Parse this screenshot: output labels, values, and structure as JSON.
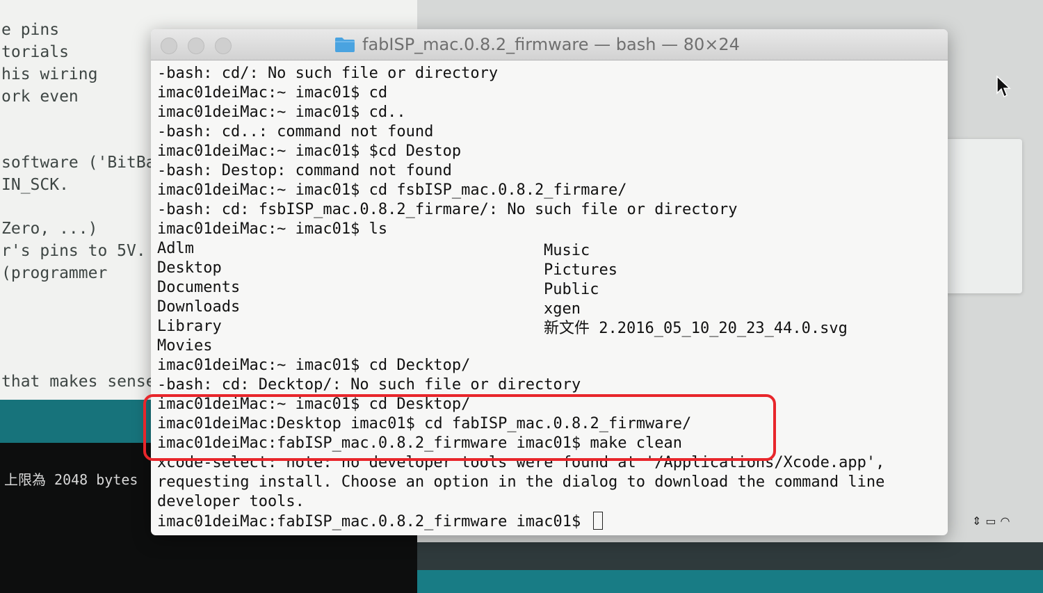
{
  "background": {
    "left_doc_lines": [
      "e pins",
      "torials",
      "his wiring",
      "ork even",
      "software ('BitBa",
      "IN_SCK.",
      "Zero, ...)",
      "r's pins to 5V.",
      "(programmer",
      "that makes sense"
    ],
    "console_line": "上限為 2048 bytes"
  },
  "terminal": {
    "title": "fabISP_mac.0.8.2_firmware — bash — 80×24",
    "lines": [
      "-bash: cd/: No such file or directory",
      "imac01deiMac:~ imac01$ cd",
      "imac01deiMac:~ imac01$ cd..",
      "-bash: cd..: command not found",
      "imac01deiMac:~ imac01$ $cd Destop",
      "-bash: Destop: command not found",
      "imac01deiMac:~ imac01$ cd fsbISP_mac.0.8.2_firmare/",
      "-bash: cd: fsbISP_mac.0.8.2_firmare/: No such file or directory",
      "imac01deiMac:~ imac01$ ls"
    ],
    "ls_left": [
      "Adlm",
      "Desktop",
      "Documents",
      "Downloads",
      "Library",
      "Movies"
    ],
    "ls_right": [
      "Music",
      "Pictures",
      "Public",
      "xgen",
      "新文件 2.2016_05_10_20_23_44.0.svg"
    ],
    "after_ls": [
      "imac01deiMac:~ imac01$ cd Decktop/",
      "-bash: cd: Decktop/: No such file or directory"
    ],
    "highlighted": [
      "imac01deiMac:~ imac01$ cd Desktop/",
      "imac01deiMac:Desktop imac01$ cd fabISP_mac.0.8.2_firmware/",
      "imac01deiMac:fabISP_mac.0.8.2_firmware imac01$ make clean"
    ],
    "output": [
      "xcode-select: note: no developer tools were found at '/Applications/Xcode.app',",
      "requesting install. Choose an option in the dialog to download the command line",
      "developer tools."
    ],
    "prompt": "imac01deiMac:fabISP_mac.0.8.2_firmware imac01$",
    "highlight_color": "#e8262b"
  }
}
